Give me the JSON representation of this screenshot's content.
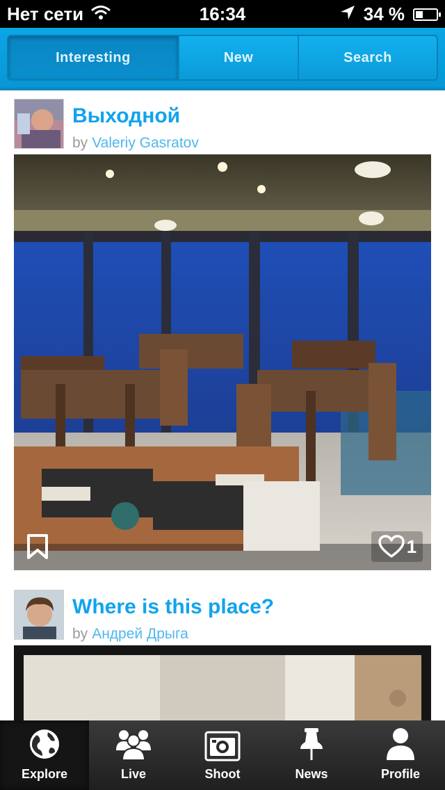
{
  "status_bar": {
    "carrier": "Нет сети",
    "time": "16:34",
    "battery": "34 %",
    "battery_level": 0.34
  },
  "segments": [
    {
      "label": "Interesting",
      "active": true
    },
    {
      "label": "New",
      "active": false
    },
    {
      "label": "Search",
      "active": false
    }
  ],
  "posts": [
    {
      "title": "Выходной",
      "by": "by",
      "author": "Valeriy Gasratov",
      "likes": "1"
    },
    {
      "title": "Where is this place?",
      "by": "by",
      "author": "Андрей Дрыга"
    }
  ],
  "tabs": [
    {
      "label": "Explore",
      "icon": "globe-icon",
      "active": true
    },
    {
      "label": "Live",
      "icon": "people-icon",
      "active": false
    },
    {
      "label": "Shoot",
      "icon": "camera-icon",
      "active": false
    },
    {
      "label": "News",
      "icon": "pin-icon",
      "active": false
    },
    {
      "label": "Profile",
      "icon": "person-icon",
      "active": false
    }
  ],
  "colors": {
    "accent": "#0aa6e6",
    "title": "#12a3ec",
    "author": "#4fb7ee",
    "tab_bar": "#2a2a2a"
  }
}
